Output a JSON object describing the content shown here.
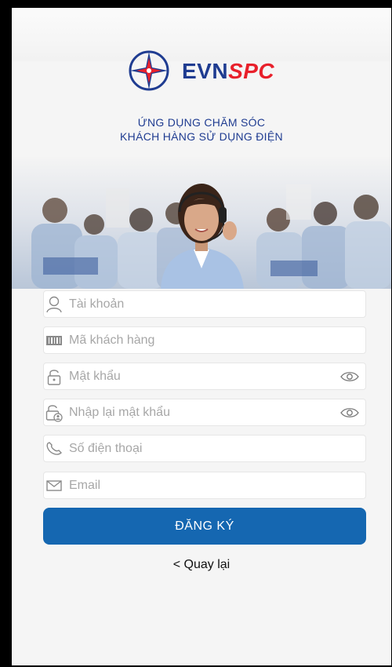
{
  "brand": {
    "name_part1": "EVN",
    "name_part2": "SPC",
    "tagline_line1": "ỨNG DỤNG CHĂM SÓC",
    "tagline_line2": "KHÁCH HÀNG SỬ DỤNG ĐIỆN",
    "primary_color": "#1f3c91",
    "accent_color": "#e8202b"
  },
  "form": {
    "account": {
      "placeholder": "Tài khoản",
      "icon": "user-icon"
    },
    "customer_code": {
      "placeholder": "Mã khách hàng",
      "icon": "barcode-icon"
    },
    "password": {
      "placeholder": "Mật khẩu",
      "icon": "lock-icon",
      "toggle_icon": "eye-icon"
    },
    "confirm_password": {
      "placeholder": "Nhập lại mật khẩu",
      "icon": "lock-user-icon",
      "toggle_icon": "eye-icon"
    },
    "phone": {
      "placeholder": "Số điện thoại",
      "icon": "phone-icon"
    },
    "email": {
      "placeholder": "Email",
      "icon": "mail-icon"
    }
  },
  "actions": {
    "register_label": "ĐĂNG KÝ",
    "register_color": "#1567b1",
    "back_label": "< Quay lại"
  }
}
